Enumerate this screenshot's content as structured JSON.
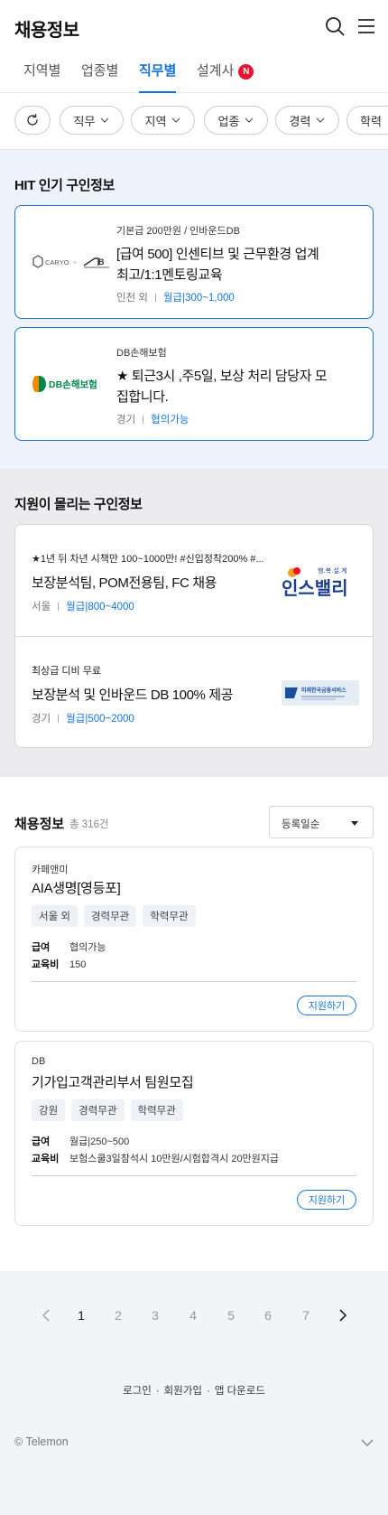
{
  "header": {
    "title": "채용정보"
  },
  "tabs": [
    {
      "label": "지역별"
    },
    {
      "label": "업종별"
    },
    {
      "label": "직무별"
    },
    {
      "label": "설계사",
      "badge": "N"
    }
  ],
  "filters": {
    "items": [
      {
        "label": "직무"
      },
      {
        "label": "지역"
      },
      {
        "label": "업종"
      },
      {
        "label": "경력"
      },
      {
        "label": "학력"
      }
    ]
  },
  "hit": {
    "title": "HIT 인기 구인정보",
    "cards": [
      {
        "logo": "CARYO × AB",
        "sub": "기본급 200만원 / 인바운드DB",
        "headline": "[급여 500] 인센티브 및 근무환경 업계 최고/1:1멘토링교육",
        "region": "인천 외",
        "pay": "월급|300~1,000"
      },
      {
        "logo": "DB손해보험",
        "sub": "DB손해보험",
        "headline": "★ 퇴근3시 ,주5일, 보상 처리 담당자 모집합니다.",
        "region": "경기",
        "pay": "협의가능"
      }
    ]
  },
  "popular": {
    "title": "지원이 몰리는 구인정보",
    "items": [
      {
        "sub": "★1년 뒤 차년 시책만 100~1000만! #신입정착200% #...",
        "headline": "보장분석팀, POM전용팀, FC 채용",
        "region": "서울",
        "pay": "월급|800~4000",
        "logo_tagline": "행.복.설.계",
        "logo_name": "인스밸리"
      },
      {
        "sub": "최상급 디비 무료",
        "headline": "보장분석 및 인바운드 DB 100% 제공",
        "region": "경기",
        "pay": "월급|500~2000",
        "logo_name": "미래한국금융서비스"
      }
    ]
  },
  "recruit": {
    "title": "채용정보",
    "count": "총 316건",
    "sort": "등록일순",
    "jobs": [
      {
        "company": "카페앤미",
        "title": "AIA생명[영등포]",
        "tags": [
          "서울 외",
          "경력무관",
          "학력무관"
        ],
        "pay_label": "급여",
        "pay": "협의가능",
        "edu_label": "교육비",
        "edu": "150",
        "apply": "지원하기"
      },
      {
        "company": "DB",
        "title": "기가입고객관리부서 팀원모집",
        "tags": [
          "강원",
          "경력무관",
          "학력무관"
        ],
        "pay_label": "급여",
        "pay": "월급|250~500",
        "edu_label": "교육비",
        "edu": "보험스쿨3일참석시 10만원/시험합격시 20만원지급",
        "apply": "지원하기"
      }
    ]
  },
  "pagination": {
    "pages": [
      "1",
      "2",
      "3",
      "4",
      "5",
      "6",
      "7"
    ],
    "current": "1"
  },
  "footer": {
    "links": [
      "로그인",
      "회원가입",
      "앱 다운로드"
    ],
    "copyright": "© Telemon"
  },
  "colors": {
    "accent": "#1673d6",
    "badge": "#e8142b",
    "hit_bg": "#eef3fb",
    "popular_bg": "#ececef"
  }
}
